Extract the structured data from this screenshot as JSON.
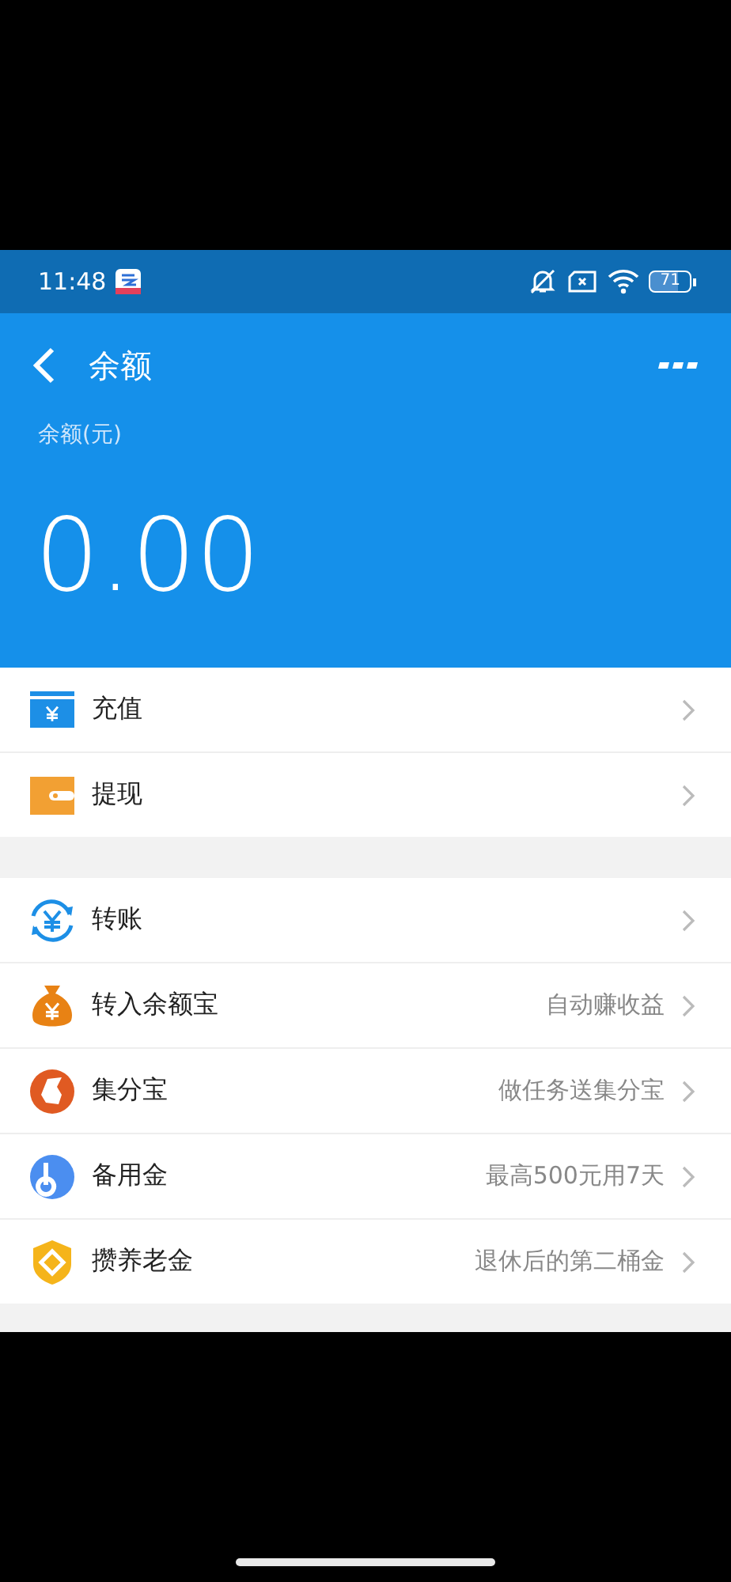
{
  "status_bar": {
    "time": "11:48",
    "battery": "71"
  },
  "header": {
    "title": "余额",
    "balance_label": "余额(元)",
    "balance": "0.00"
  },
  "sections": [
    {
      "items": [
        {
          "kind": "topup",
          "label": "充值"
        },
        {
          "kind": "withdraw",
          "label": "提现"
        }
      ]
    },
    {
      "items": [
        {
          "kind": "transfer",
          "label": "转账"
        },
        {
          "kind": "moneybag",
          "label": "转入余额宝",
          "hint": "自动赚收益"
        },
        {
          "kind": "points",
          "label": "集分宝",
          "hint": "做任务送集分宝"
        },
        {
          "kind": "reserve",
          "label": "备用金",
          "hint": "最高500元用7天"
        },
        {
          "kind": "pension",
          "label": "攒养老金",
          "hint": "退休后的第二桶金"
        }
      ]
    }
  ]
}
